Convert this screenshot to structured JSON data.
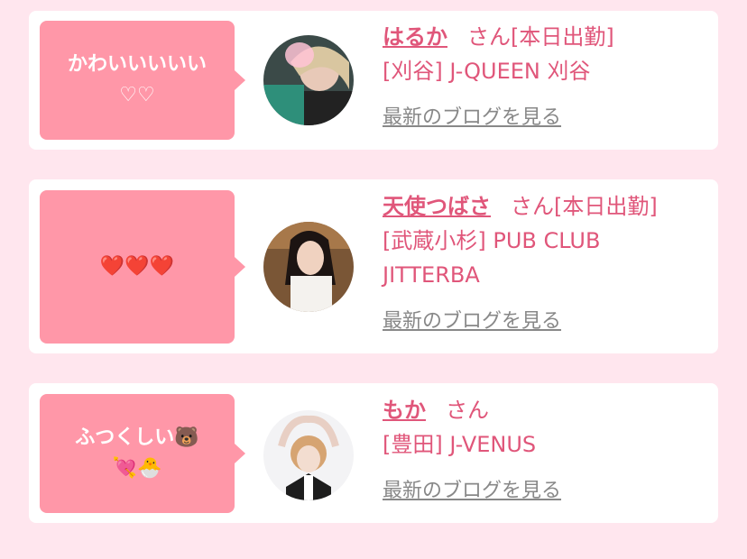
{
  "cards": [
    {
      "comment": "かわいいいいい♡♡",
      "name": "はるか",
      "suffix": "さん[本日出勤]",
      "shop": "[刈谷] J-QUEEN 刈谷",
      "blog_link": "最新のブログを見る",
      "avatar_icon": "avatar-photo"
    },
    {
      "comment": "❤️❤️❤️",
      "name": "天使つばさ",
      "suffix": "さん[本日出勤]",
      "shop": "[武蔵小杉] PUB CLUB JITTERBA",
      "blog_link": "最新のブログを見る",
      "avatar_icon": "avatar-photo"
    },
    {
      "comment": "ふつくしい🐻💘🐣",
      "name": "もか",
      "suffix": "さん",
      "shop": "[豊田] J-VENUS",
      "blog_link": "最新のブログを見る",
      "avatar_icon": "avatar-photo"
    }
  ]
}
